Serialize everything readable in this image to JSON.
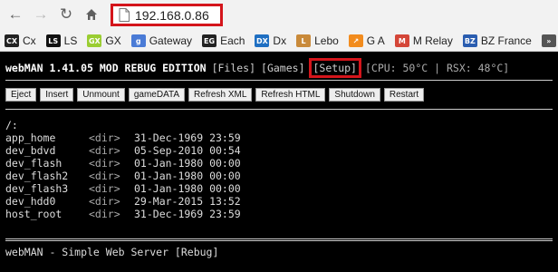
{
  "browser": {
    "url": "192.168.0.86",
    "bookmarks": [
      {
        "label": "Cx",
        "icon": "cx-icon",
        "color": "#222222",
        "glyph": "CX"
      },
      {
        "label": "LS",
        "icon": "ls-icon",
        "color": "#111111",
        "glyph": "LS"
      },
      {
        "label": "GX",
        "icon": "gx-icon",
        "color": "#9acd32",
        "glyph": "GX"
      },
      {
        "label": "Gateway",
        "icon": "google-icon",
        "color": "#4a7bd6",
        "glyph": "g"
      },
      {
        "label": "Each",
        "icon": "eg-icon",
        "color": "#222222",
        "glyph": "EG"
      },
      {
        "label": "Dx",
        "icon": "dx-icon",
        "color": "#1f6fc2",
        "glyph": "DX"
      },
      {
        "label": "Lebo",
        "icon": "box-icon",
        "color": "#c98a3a",
        "glyph": "L"
      },
      {
        "label": "G A",
        "icon": "analytics-icon",
        "color": "#f28c1e",
        "glyph": "↗"
      },
      {
        "label": "M Relay",
        "icon": "gmail-icon",
        "color": "#d44638",
        "glyph": "M"
      },
      {
        "label": "BZ France",
        "icon": "bz-icon",
        "color": "#2a5db0",
        "glyph": "BZ"
      },
      {
        "label": "",
        "icon": "more-bookmarks-icon",
        "color": "#555555",
        "glyph": "»"
      }
    ]
  },
  "header": {
    "title": "webMAN 1.41.05 MOD REBUG EDITION",
    "files": "[Files]",
    "games": "[Games]",
    "setup": "[Setup]",
    "status": "[CPU: 50°C | RSX: 48°C]"
  },
  "buttons": [
    "Eject",
    "Insert",
    "Unmount",
    "gameDATA",
    "Refresh XML",
    "Refresh HTML",
    "Shutdown",
    "Restart"
  ],
  "listing": {
    "path": "/:",
    "rows": [
      {
        "name": "app_home",
        "type": "<dir>",
        "date": "31-Dec-1969 23:59"
      },
      {
        "name": "dev_bdvd",
        "type": "<dir>",
        "date": "05-Sep-2010 00:54"
      },
      {
        "name": "dev_flash",
        "type": "<dir>",
        "date": "01-Jan-1980 00:00"
      },
      {
        "name": "dev_flash2",
        "type": "<dir>",
        "date": "01-Jan-1980 00:00"
      },
      {
        "name": "dev_flash3",
        "type": "<dir>",
        "date": "01-Jan-1980 00:00"
      },
      {
        "name": "dev_hdd0",
        "type": "<dir>",
        "date": "29-Mar-2015 13:52"
      },
      {
        "name": "host_root",
        "type": "<dir>",
        "date": "31-Dec-1969 23:59"
      }
    ]
  },
  "footer": "webMAN - Simple Web Server [Rebug]"
}
